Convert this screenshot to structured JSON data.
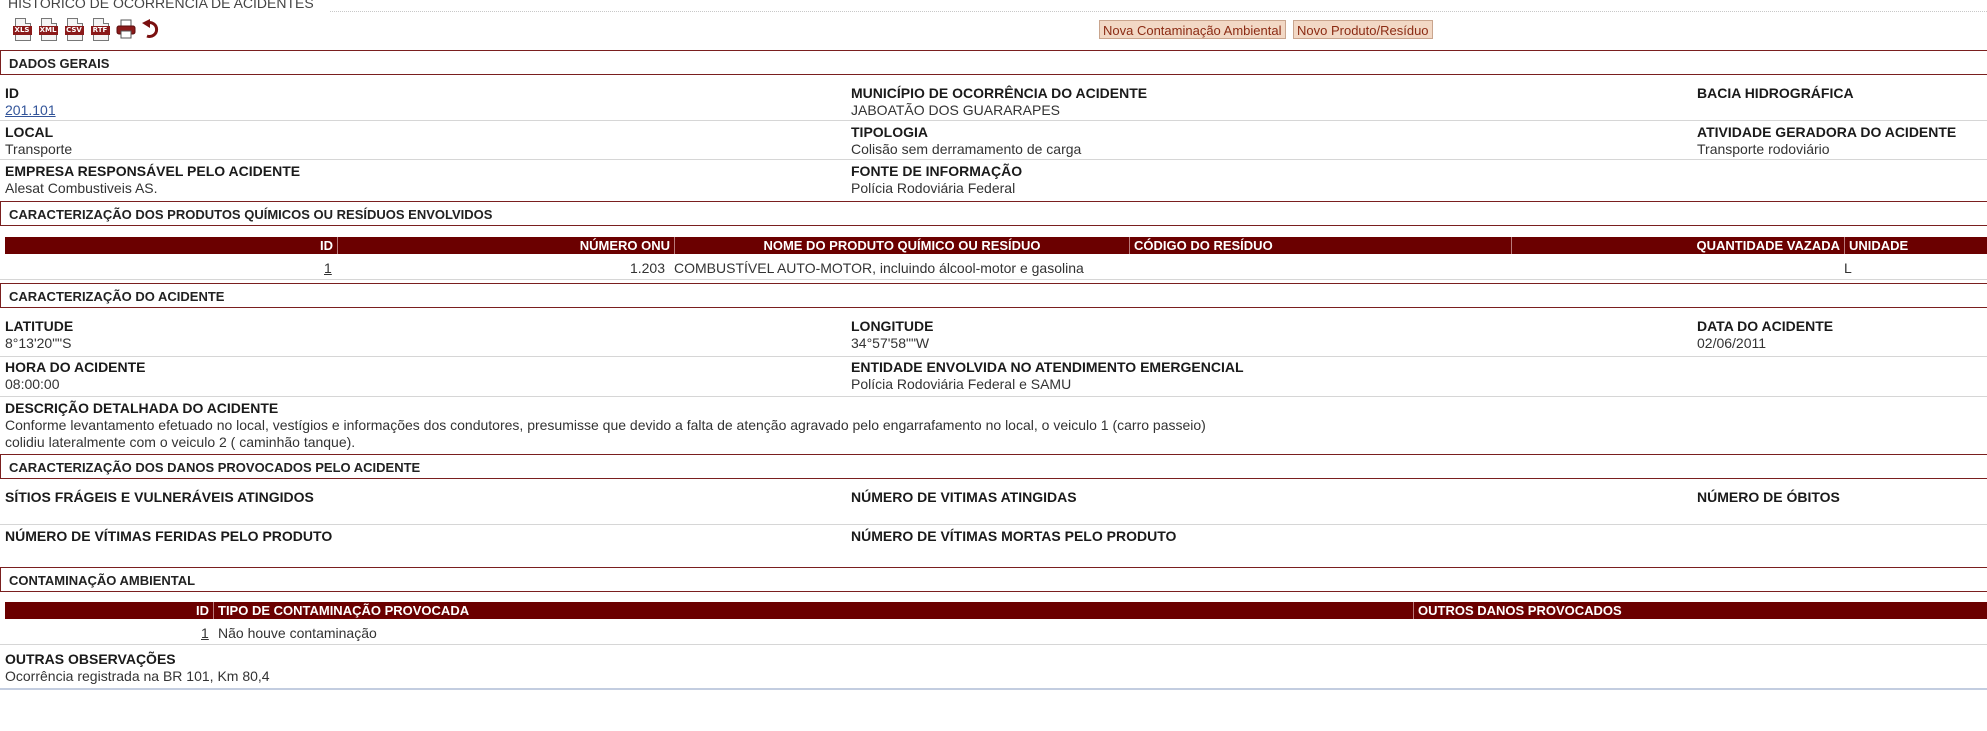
{
  "page": {
    "title": "HISTÓRICO DE OCORRÊNCIA DE ACIDENTES"
  },
  "toolbar": {
    "icons": [
      {
        "name": "xls-export-icon",
        "tag": "XLS"
      },
      {
        "name": "xml-export-icon",
        "tag": "XML"
      },
      {
        "name": "csv-export-icon",
        "tag": "CSV"
      },
      {
        "name": "rtf-export-icon",
        "tag": "RTF"
      },
      {
        "name": "print-icon"
      },
      {
        "name": "undo-icon"
      }
    ],
    "new_contamination_label": "Nova Contaminação Ambiental",
    "new_product_label": "Novo Produto/Resíduo"
  },
  "dados_gerais": {
    "heading": "DADOS GERAIS",
    "id_label": "ID",
    "id_value": "201.101",
    "municipio_label": "MUNICÍPIO DE OCORRÊNCIA DO ACIDENTE",
    "municipio_value": "JABOATÃO DOS GUARARAPES",
    "bacia_label": "BACIA HIDROGRÁFICA",
    "local_label": "LOCAL",
    "local_value": "Transporte",
    "tipologia_label": "TIPOLOGIA",
    "tipologia_value": "Colisão sem derramamento de carga",
    "atividade_label": "ATIVIDADE GERADORA DO ACIDENTE",
    "atividade_value": "Transporte rodoviário",
    "empresa_label": "EMPRESA RESPONSÁVEL PELO ACIDENTE",
    "empresa_value": "Alesat Combustiveis AS.",
    "fonte_label": "FONTE DE INFORMAÇÃO",
    "fonte_value": "Polícia Rodoviária Federal"
  },
  "produtos": {
    "heading": "CARACTERIZAÇÃO DOS PRODUTOS QUÍMICOS OU RESÍDUOS ENVOLVIDOS",
    "columns": [
      "ID",
      "NÚMERO ONU",
      "NOME DO PRODUTO QUÍMICO OU RESÍDUO",
      "CÓDIGO DO RESÍDUO",
      "QUANTIDADE VAZADA",
      "UNIDADE"
    ],
    "rows": [
      {
        "id": "1",
        "onu": "1.203",
        "nome": "COMBUSTÍVEL AUTO-MOTOR, incluindo álcool-motor e gasolina",
        "codigo": "",
        "quantidade": "",
        "unidade": "L"
      }
    ]
  },
  "acidente": {
    "heading": "CARACTERIZAÇÃO DO ACIDENTE",
    "latitude_label": "LATITUDE",
    "latitude_value": "8°13'20\"\"S",
    "longitude_label": "LONGITUDE",
    "longitude_value": "34°57'58\"\"W",
    "data_label": "DATA DO ACIDENTE",
    "data_value": "02/06/2011",
    "hora_label": "HORA DO ACIDENTE",
    "hora_value": "08:00:00",
    "entidade_label": "ENTIDADE ENVOLVIDA NO ATENDIMENTO EMERGENCIAL",
    "entidade_value": "Polícia Rodoviária Federal e SAMU",
    "descricao_label": "DESCRIÇÃO DETALHADA DO ACIDENTE",
    "descricao_line1": "Conforme levantamento efetuado no local, vestígios e informações dos condutores, presumisse que devido a falta de atenção agravado pelo engarrafamento no local, o veiculo 1 (carro passeio)",
    "descricao_line2": "colidiu lateralmente com o veiculo 2 ( caminhão tanque)."
  },
  "danos": {
    "heading": "CARACTERIZAÇÃO DOS DANOS PROVOCADOS PELO ACIDENTE",
    "sitios_label": "SÍTIOS FRÁGEIS E VULNERÁVEIS ATINGIDOS",
    "vitimas_label": "NÚMERO DE VITIMAS ATINGIDAS",
    "obitos_label": "NÚMERO DE ÓBITOS",
    "feridas_label": "NÚMERO DE VÍTIMAS FERIDAS PELO PRODUTO",
    "mortas_label": "NÚMERO DE VÍTIMAS MORTAS PELO PRODUTO"
  },
  "contaminacao": {
    "heading": "CONTAMINAÇÃO AMBIENTAL",
    "columns": [
      "ID",
      "TIPO DE CONTAMINAÇÃO PROVOCADA",
      "OUTROS DANOS PROVOCADOS"
    ],
    "rows": [
      {
        "id": "1",
        "tipo": "Não houve contaminação",
        "outros": ""
      }
    ]
  },
  "observacoes": {
    "label": "OUTRAS OBSERVAÇÕES",
    "value": "Ocorrência registrada na BR 101, Km 80,4"
  },
  "colors": {
    "accent": "#6b0000",
    "section_border": "#7a1f1f",
    "button_bg": "#f2d8c5",
    "link": "#33559a"
  }
}
